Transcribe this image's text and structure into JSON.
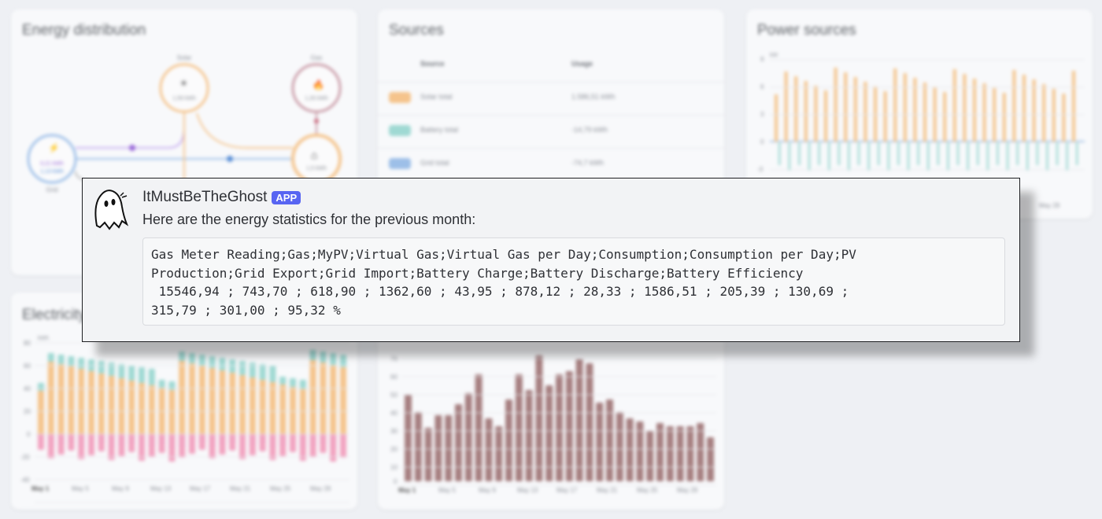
{
  "dashboard": {
    "energy_distribution": {
      "title": "Energy distribution",
      "nodes": {
        "solar": {
          "label": "Solar",
          "value": "1,59 kWh"
        },
        "gas": {
          "label": "Gas",
          "value": "1,26 kWh"
        },
        "grid": {
          "label": "Grid",
          "value_in": "0,21 kWh",
          "value_out": "1,13 kWh"
        },
        "home": {
          "value": "1,5 kWh"
        }
      }
    },
    "sources": {
      "title": "Sources",
      "columns": [
        "Source",
        "Usage"
      ],
      "rows": [
        {
          "name": "Solar total",
          "usage": "1.586,51 kWh",
          "color": "#f5c48c"
        },
        {
          "name": "Battery total",
          "usage": "-14,79 kWh",
          "color": "#9fd9d3"
        },
        {
          "name": "Grid total",
          "usage": "-74,7 kWh",
          "color": "#9dbfe8"
        }
      ]
    },
    "power_sources": {
      "title": "Power sources",
      "unit": "kW",
      "y_ticks": [
        "9",
        "6",
        "3",
        "0",
        "-3"
      ],
      "x_ticks": [
        "May 29"
      ]
    },
    "electricity": {
      "title": "Electricity",
      "unit": "kWh",
      "y_ticks": [
        "80",
        "60",
        "40",
        "20",
        "0",
        "-20",
        "-40"
      ],
      "x_ticks": [
        "May 1",
        "May 5",
        "May 9",
        "May 13",
        "May 17",
        "May 21",
        "May 25",
        "May 29"
      ]
    },
    "gas_chart": {
      "y_ticks": [
        "70",
        "60",
        "50",
        "40",
        "30",
        "20",
        "10",
        "0"
      ],
      "x_ticks": [
        "May 1",
        "May 5",
        "May 9",
        "May 13",
        "May 17",
        "May 21",
        "May 25",
        "May 29"
      ]
    }
  },
  "message": {
    "username": "ItMustBeTheGhost",
    "badge": "APP",
    "text": "Here are the energy statistics for the previous month:",
    "code": "Gas Meter Reading;Gas;MyPV;Virtual Gas;Virtual Gas per Day;Consumption;Consumption per Day;PV\nProduction;Grid Export;Grid Import;Battery Charge;Battery Discharge;Battery Efficiency\n 15546,94 ; 743,70 ; 618,90 ; 1362,60 ; 43,95 ; 878,12 ; 28,33 ; 1586,51 ; 205,39 ; 130,69 ;\n315,79 ; 301,00 ; 95,32 %",
    "avatar_icon": "ghost-icon"
  },
  "colors": {
    "solar": "#f5c48c",
    "battery": "#9fd9d3",
    "grid": "#9dbfe8",
    "export": "#f2a3c0",
    "battery_charge": "#c2aef0",
    "gas": "#a67f80",
    "discord_badge": "#5865f2"
  }
}
